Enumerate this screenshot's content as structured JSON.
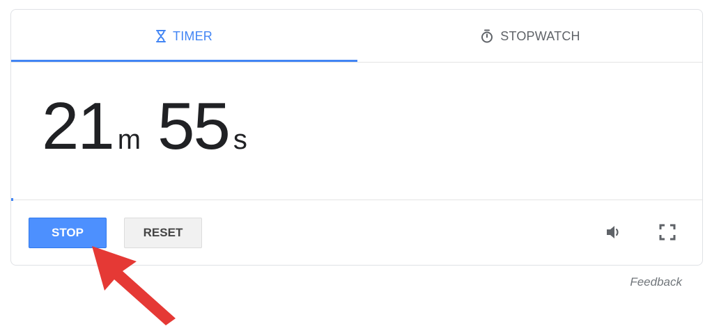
{
  "tabs": [
    {
      "label": "TIMER",
      "icon": "hourglass-icon",
      "active": true
    },
    {
      "label": "STOPWATCH",
      "icon": "stopwatch-icon",
      "active": false
    }
  ],
  "timer": {
    "minutes": "21",
    "minutes_unit": "m",
    "seconds": "55",
    "seconds_unit": "s"
  },
  "controls": {
    "stop_label": "STOP",
    "reset_label": "RESET",
    "volume_icon": "volume-icon",
    "fullscreen_icon": "fullscreen-icon"
  },
  "feedback_label": "Feedback",
  "colors": {
    "accent": "#4285f4",
    "stop_button": "#4d90fe",
    "annotation_arrow": "#e53935"
  },
  "annotation": {
    "icon": "red-arrow-icon",
    "target": "stop-button"
  }
}
